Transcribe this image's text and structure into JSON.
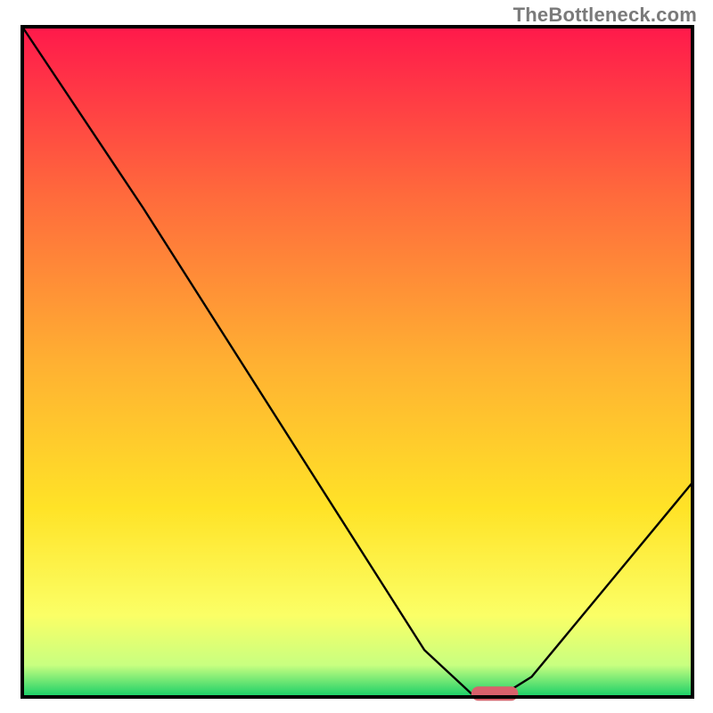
{
  "watermark": "TheBottleneck.com",
  "chart_data": {
    "type": "line",
    "title": "",
    "xlabel": "",
    "ylabel": "",
    "xlim": [
      0,
      100
    ],
    "ylim": [
      0,
      100
    ],
    "grid": false,
    "legend": false,
    "background_gradient": {
      "stops": [
        {
          "offset": 0.0,
          "color": "#ff1a4b"
        },
        {
          "offset": 0.25,
          "color": "#ff6a3c"
        },
        {
          "offset": 0.5,
          "color": "#ffb032"
        },
        {
          "offset": 0.72,
          "color": "#ffe327"
        },
        {
          "offset": 0.88,
          "color": "#fbff66"
        },
        {
          "offset": 0.955,
          "color": "#c8ff80"
        },
        {
          "offset": 1.0,
          "color": "#1fd169"
        }
      ]
    },
    "series": [
      {
        "name": "bottleneck-curve",
        "color": "#000000",
        "x": [
          0,
          18,
          60,
          67,
          72,
          76,
          100
        ],
        "values": [
          100,
          73,
          7,
          0.5,
          0.5,
          3,
          32
        ]
      }
    ],
    "marker": {
      "name": "optimal-point",
      "x_range": [
        67,
        74
      ],
      "y": 0.5,
      "color": "#d8616b"
    }
  }
}
